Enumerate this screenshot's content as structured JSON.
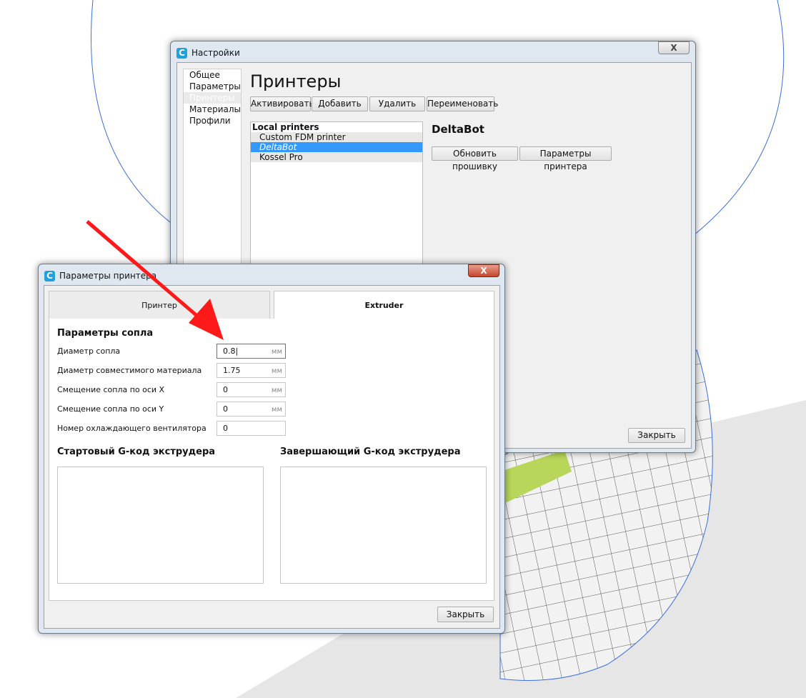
{
  "settings": {
    "title": "Настройки",
    "close_x": "X",
    "sidebar": [
      "Общее",
      "Параметры",
      "Принтеры",
      "Материалы",
      "Профили"
    ],
    "heading": "Принтеры",
    "buttons": [
      "Активировать",
      "Добавить",
      "Удалить",
      "Переименовать"
    ],
    "list_header": "Local printers",
    "printers": [
      "Custom FDM printer",
      "DeltaBot",
      "Kossel Pro"
    ],
    "selected_name": "DeltaBot",
    "actions": [
      "Обновить прошивку",
      "Параметры принтера"
    ],
    "close": "Закрыть"
  },
  "dialog": {
    "title": "Параметры принтера",
    "close_x": "X",
    "tabs": [
      "Принтер",
      "Extruder"
    ],
    "section": "Параметры сопла",
    "fields": [
      {
        "label": "Диаметр сопла",
        "value": "0.8",
        "unit": "мм"
      },
      {
        "label": "Диаметр совместимого материала",
        "value": "1.75",
        "unit": "мм"
      },
      {
        "label": "Смещение сопла по оси X",
        "value": "0",
        "unit": "мм"
      },
      {
        "label": "Смещение сопла по оси Y",
        "value": "0",
        "unit": "мм"
      },
      {
        "label": "Номер охлаждающего вентилятора",
        "value": "0",
        "unit": ""
      }
    ],
    "start_gcode": "Стартовый G-код экструдера",
    "end_gcode": "Завершающий G-код экструдера",
    "close": "Закрыть"
  },
  "colors": {
    "selection": "#3399ff",
    "arrow": "#ff1a1a",
    "icon": "#1ea1dd"
  }
}
